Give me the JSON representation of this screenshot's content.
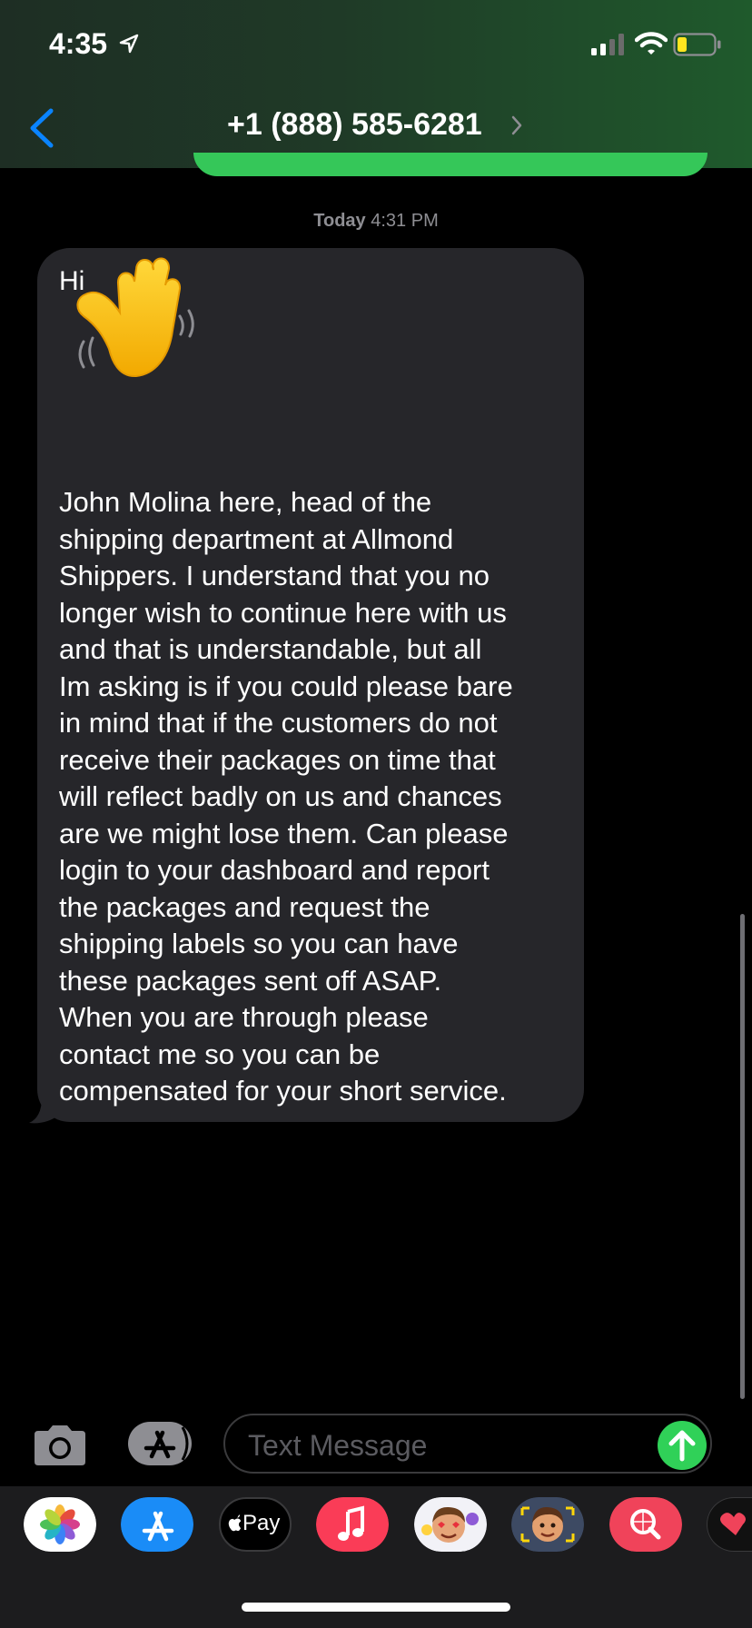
{
  "status_bar": {
    "time": "4:35",
    "icons": [
      "location-arrow-icon",
      "cellular-signal-icon",
      "wifi-icon",
      "battery-icon"
    ],
    "battery_color": "#ffe51f"
  },
  "nav": {
    "back_icon": "chevron-left-icon",
    "contact": "+1 (888) 585-6281",
    "accent_color": "#0a84ff"
  },
  "conversation": {
    "timestamp_day": "Today",
    "timestamp_time": "4:31 PM",
    "incoming_message": {
      "greeting": "Hi",
      "emoji": "waving-hand-emoji",
      "body": "John Molina here, head of the\nshipping department at Allmond\nShippers. I understand that you no\nlonger wish to continue here with us\nand that is understandable, but all\nIm asking is if you could please bare\nin mind that if the customers do not\nreceive their packages on time that\nwill reflect badly on us and chances\nare we might lose them. Can please\nlogin to your dashboard and report\nthe packages and request the\nshipping labels so you can have\nthese packages sent off ASAP.\nWhen you are through please\ncontact me so you can be\ncompensated for your short service."
    },
    "bubble_color": "#26262a",
    "outgoing_color": "#35c759"
  },
  "composer": {
    "placeholder": "Text Message",
    "camera_icon": "camera-icon",
    "appstore_icon": "app-store-icon",
    "send_icon": "arrow-up-icon",
    "send_color": "#30d158"
  },
  "app_drawer": {
    "apps": [
      {
        "name": "Photos",
        "icon": "photos-icon"
      },
      {
        "name": "App Store",
        "icon": "app-store-icon"
      },
      {
        "name": "Apple Pay",
        "label": "Pay",
        "icon": "apple-pay-icon"
      },
      {
        "name": "Music",
        "icon": "music-note-icon"
      },
      {
        "name": "Memoji Stickers",
        "icon": "memoji-stickers-icon"
      },
      {
        "name": "Animoji",
        "icon": "animoji-icon"
      },
      {
        "name": "Images",
        "icon": "images-search-icon"
      },
      {
        "name": "Digital Touch",
        "icon": "digital-touch-icon"
      }
    ]
  }
}
